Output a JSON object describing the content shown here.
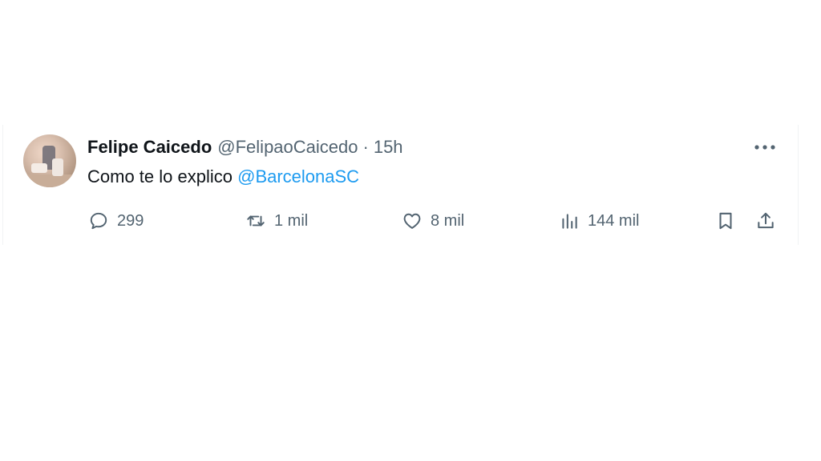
{
  "tweet": {
    "author_name": "Felipe Caicedo",
    "handle": "@FelipaoCaicedo",
    "separator": "·",
    "time": "15h",
    "text": "Como te lo explico",
    "mention": "@BarcelonaSC",
    "more_icon": "more-horizontal-icon"
  },
  "actions": {
    "replies": "299",
    "retweets": "1 mil",
    "likes": "8 mil",
    "views": "144 mil"
  },
  "colors": {
    "text": "#0f1419",
    "secondary": "#536471",
    "link": "#1d9bf0"
  }
}
